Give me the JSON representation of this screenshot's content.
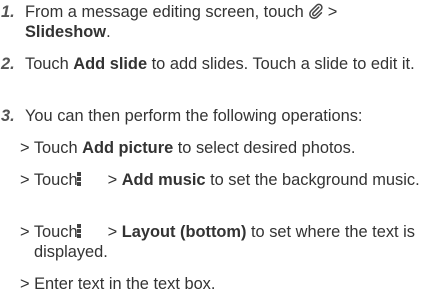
{
  "steps": [
    {
      "num": "1.",
      "parts": [
        "From a message editing screen, touch",
        ">",
        "Slideshow",
        "."
      ]
    },
    {
      "num": "2.",
      "parts": [
        "Touch ",
        "Add slide",
        " to add slides. Touch a slide to edit it."
      ]
    },
    {
      "num": "3.",
      "parts": [
        "You can then perform the following operations:"
      ]
    }
  ],
  "operations": [
    {
      "parts": [
        "> Touch ",
        "Add picture",
        " to select desired photos."
      ]
    },
    {
      "parts": [
        "> Touch",
        "> ",
        "Add music",
        " to set the background music."
      ]
    },
    {
      "parts": [
        "> Touch",
        "> ",
        "Layout (bottom)",
        " to set where the text is displayed."
      ]
    },
    {
      "parts": [
        "> Enter text in the text box."
      ]
    }
  ],
  "icons": {
    "attach": "paperclip-icon",
    "menu": "overflow-menu-icon"
  },
  "colors": {
    "text": "#333333",
    "number": "#555555",
    "icon": "#444444"
  }
}
